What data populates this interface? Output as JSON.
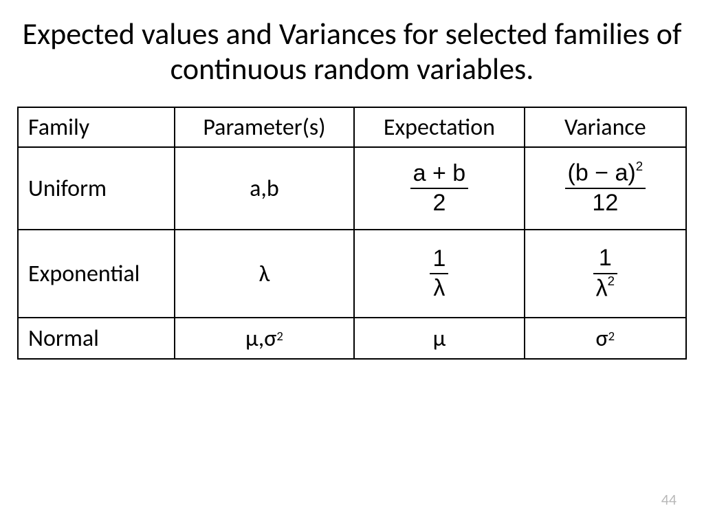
{
  "title": "Expected values and Variances for selected families of continuous random variables.",
  "headers": {
    "c1": "Family",
    "c2": "Parameter(s)",
    "c3": "Expectation",
    "c4": "Variance"
  },
  "rows": {
    "uniform": {
      "family": "Uniform",
      "params": "a,b",
      "expectation": {
        "num": "a + b",
        "den": "2"
      },
      "variance": {
        "num_base": "(b − a)",
        "num_exp": "2",
        "den": "12"
      }
    },
    "exponential": {
      "family": "Exponential",
      "params": "λ",
      "expectation": {
        "num": "1",
        "den": "λ"
      },
      "variance": {
        "num": "1",
        "den_base": "λ",
        "den_exp": "2"
      }
    },
    "normal": {
      "family": "Normal",
      "params_mu": "μ,",
      "params_sigma": "σ",
      "params_exp": "2",
      "expectation": "μ",
      "variance_base": "σ",
      "variance_exp": "2"
    }
  },
  "slide_number": "44"
}
